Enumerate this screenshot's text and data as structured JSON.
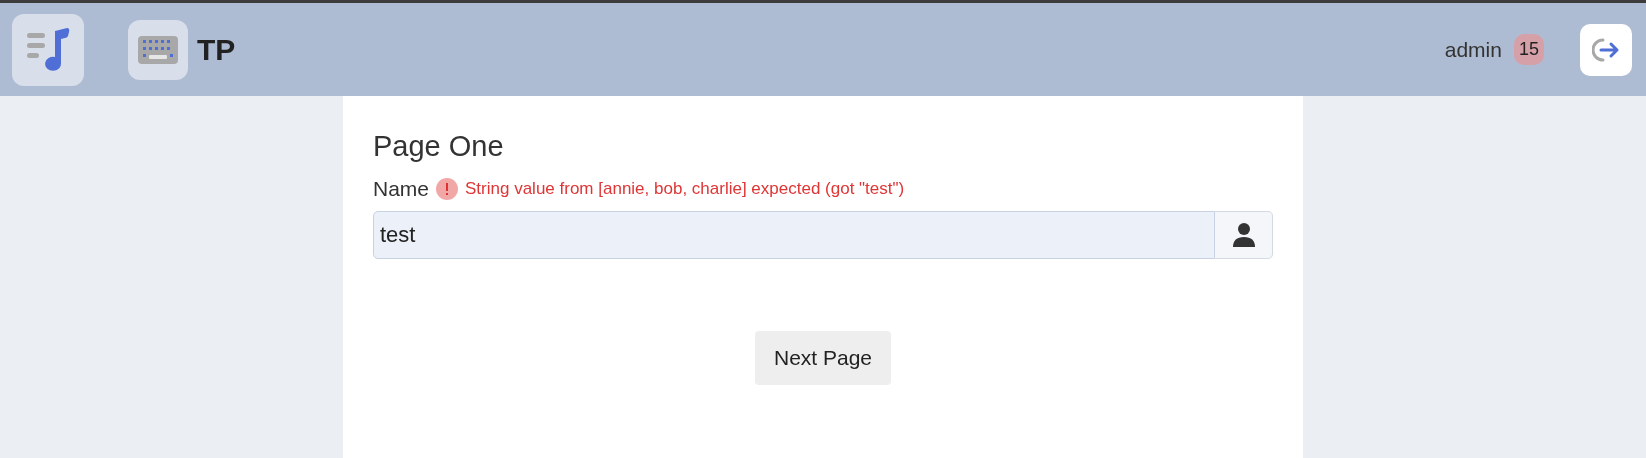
{
  "header": {
    "app_title": "TP",
    "user": "admin",
    "badge": "15"
  },
  "page": {
    "title": "Page One",
    "field": {
      "label": "Name",
      "error": "String value from [annie, bob, charlie] expected (got \"test\")",
      "value": "test",
      "invalid": true
    },
    "button": "Next Page"
  }
}
